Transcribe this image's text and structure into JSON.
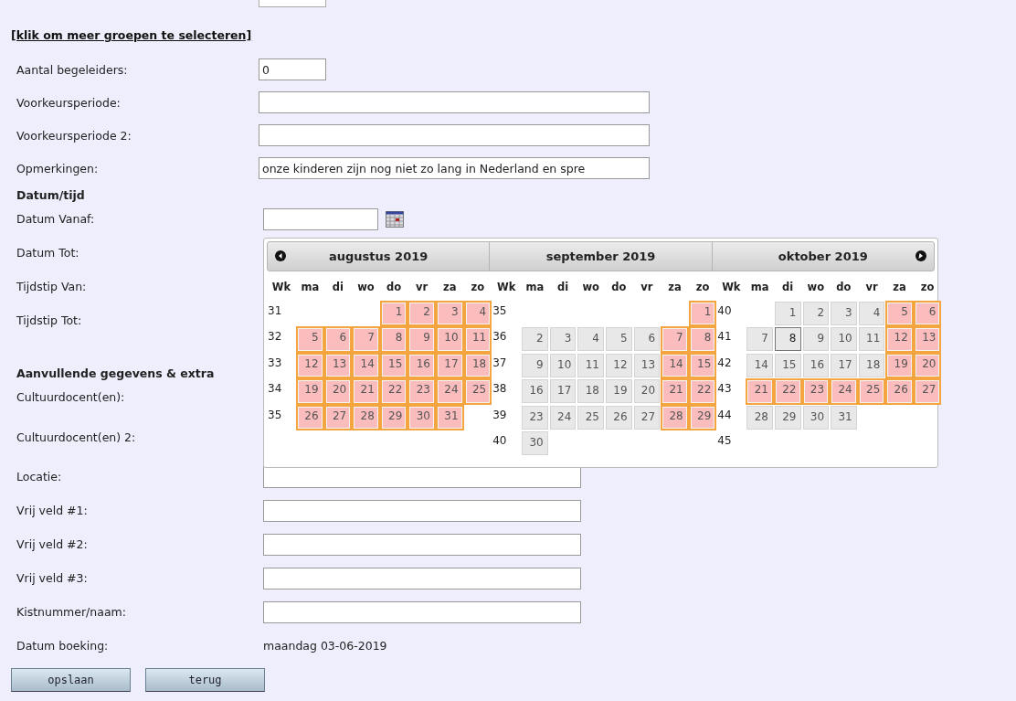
{
  "link": "[klik om meer groepen te selecteren]",
  "fields": [
    {
      "label": "Aantal begeleiders:",
      "kind": "short",
      "value": "0"
    },
    {
      "label": "Voorkeursperiode:",
      "kind": "wide"
    },
    {
      "label": "Voorkeursperiode 2:",
      "kind": "wide"
    },
    {
      "label": "Opmerkingen:",
      "kind": "wide",
      "value": "onze kinderen zijn nog niet zo lang in Nederland en spre"
    }
  ],
  "datetime": {
    "heading": "Datum/tijd",
    "rows": [
      {
        "label": "Datum Vanaf:",
        "kind": "date"
      },
      {
        "label": "Datum Tot:",
        "kind": "covered"
      },
      {
        "label": "Tijdstip Van:",
        "kind": "covered"
      },
      {
        "label": "Tijdstip Tot:",
        "kind": "covered"
      }
    ]
  },
  "extra": {
    "heading": "Aanvullende gegevens & extra",
    "rows": [
      {
        "label": "Cultuurdocent(en):",
        "kind": "covered"
      },
      {
        "label": "Cultuurdocent(en) 2:",
        "kind": "covered"
      },
      {
        "label": "Locatie:",
        "kind": "text"
      },
      {
        "label": "Vrij veld #1:",
        "kind": "text"
      },
      {
        "label": "Vrij veld #2:",
        "kind": "text"
      },
      {
        "label": "Vrij veld #3:",
        "kind": "text"
      },
      {
        "label": "Kistnummer/naam:",
        "kind": "text"
      },
      {
        "label": "Datum boeking:",
        "kind": "static",
        "value": "maandag 03-06-2019"
      }
    ]
  },
  "buttons": [
    "opslaan",
    "terug"
  ],
  "calendar": {
    "months": [
      {
        "title": "augustus 2019",
        "header": [
          "Wk",
          "ma",
          "di",
          "wo",
          "do",
          "vr",
          "za",
          "zo"
        ],
        "weeks": [
          {
            "wk": "31",
            "kind": "first",
            "days": [
              {
                "n": "1",
                "marked": true,
                "today": false
              },
              {
                "n": "2",
                "marked": true,
                "today": false
              },
              {
                "n": "3",
                "marked": true,
                "today": false
              },
              {
                "n": "4",
                "marked": true,
                "today": false
              }
            ]
          },
          {
            "wk": "32",
            "days": [
              {
                "n": "5",
                "marked": true,
                "today": false
              },
              {
                "n": "6",
                "marked": true,
                "today": false
              },
              {
                "n": "7",
                "marked": true,
                "today": false
              },
              {
                "n": "8",
                "marked": true,
                "today": false
              },
              {
                "n": "9",
                "marked": true,
                "today": false
              },
              {
                "n": "10",
                "marked": true,
                "today": false
              },
              {
                "n": "11",
                "marked": true,
                "today": false
              }
            ]
          },
          {
            "wk": "33",
            "days": [
              {
                "n": "12",
                "marked": true,
                "today": false
              },
              {
                "n": "13",
                "marked": true,
                "today": false
              },
              {
                "n": "14",
                "marked": true,
                "today": false
              },
              {
                "n": "15",
                "marked": true,
                "today": false
              },
              {
                "n": "16",
                "marked": true,
                "today": false
              },
              {
                "n": "17",
                "marked": true,
                "today": false
              },
              {
                "n": "18",
                "marked": true,
                "today": false
              }
            ]
          },
          {
            "wk": "34",
            "days": [
              {
                "n": "19",
                "marked": true,
                "today": false
              },
              {
                "n": "20",
                "marked": true,
                "today": false
              },
              {
                "n": "21",
                "marked": true,
                "today": false
              },
              {
                "n": "22",
                "marked": true,
                "today": false
              },
              {
                "n": "23",
                "marked": true,
                "today": false
              },
              {
                "n": "24",
                "marked": true,
                "today": false
              },
              {
                "n": "25",
                "marked": true,
                "today": false
              }
            ]
          },
          {
            "wk": "35",
            "days": [
              {
                "n": "26",
                "marked": true,
                "today": false
              },
              {
                "n": "27",
                "marked": true,
                "today": false
              },
              {
                "n": "28",
                "marked": true,
                "today": false
              },
              {
                "n": "29",
                "marked": true,
                "today": false
              },
              {
                "n": "30",
                "marked": true,
                "today": false
              },
              {
                "n": "31",
                "marked": true,
                "today": false
              }
            ]
          }
        ]
      },
      {
        "title": "september 2019",
        "header": [
          "Wk",
          "ma",
          "di",
          "wo",
          "do",
          "vr",
          "za",
          "zo"
        ],
        "weeks": [
          {
            "wk": "35",
            "kind": "first",
            "days": [
              {
                "n": "1",
                "marked": true,
                "today": false
              }
            ]
          },
          {
            "wk": "36",
            "days": [
              {
                "n": "2",
                "marked": false,
                "today": false
              },
              {
                "n": "3",
                "marked": false,
                "today": false
              },
              {
                "n": "4",
                "marked": false,
                "today": false
              },
              {
                "n": "5",
                "marked": false,
                "today": false
              },
              {
                "n": "6",
                "marked": false,
                "today": false
              },
              {
                "n": "7",
                "marked": true,
                "today": false
              },
              {
                "n": "8",
                "marked": true,
                "today": false
              }
            ]
          },
          {
            "wk": "37",
            "days": [
              {
                "n": "9",
                "marked": false,
                "today": false
              },
              {
                "n": "10",
                "marked": false,
                "today": false
              },
              {
                "n": "11",
                "marked": false,
                "today": false
              },
              {
                "n": "12",
                "marked": false,
                "today": false
              },
              {
                "n": "13",
                "marked": false,
                "today": false
              },
              {
                "n": "14",
                "marked": true,
                "today": false
              },
              {
                "n": "15",
                "marked": true,
                "today": false
              }
            ]
          },
          {
            "wk": "38",
            "days": [
              {
                "n": "16",
                "marked": false,
                "today": false
              },
              {
                "n": "17",
                "marked": false,
                "today": false
              },
              {
                "n": "18",
                "marked": false,
                "today": false
              },
              {
                "n": "19",
                "marked": false,
                "today": false
              },
              {
                "n": "20",
                "marked": false,
                "today": false
              },
              {
                "n": "21",
                "marked": true,
                "today": false
              },
              {
                "n": "22",
                "marked": true,
                "today": false
              }
            ]
          },
          {
            "wk": "39",
            "days": [
              {
                "n": "23",
                "marked": false,
                "today": false
              },
              {
                "n": "24",
                "marked": false,
                "today": false
              },
              {
                "n": "25",
                "marked": false,
                "today": false
              },
              {
                "n": "26",
                "marked": false,
                "today": false
              },
              {
                "n": "27",
                "marked": false,
                "today": false
              },
              {
                "n": "28",
                "marked": true,
                "today": false
              },
              {
                "n": "29",
                "marked": true,
                "today": false
              }
            ]
          },
          {
            "wk": "40",
            "days": [
              {
                "n": "30",
                "marked": false,
                "today": false
              }
            ]
          }
        ]
      },
      {
        "title": "oktober 2019",
        "header": [
          "Wk",
          "ma",
          "di",
          "wo",
          "do",
          "vr",
          "za",
          "zo"
        ],
        "weeks": [
          {
            "wk": "40",
            "kind": "first",
            "days": [
              {
                "n": "1",
                "marked": false,
                "today": false
              },
              {
                "n": "2",
                "marked": false,
                "today": false
              },
              {
                "n": "3",
                "marked": false,
                "today": false
              },
              {
                "n": "4",
                "marked": false,
                "today": false
              },
              {
                "n": "5",
                "marked": true,
                "today": false
              },
              {
                "n": "6",
                "marked": true,
                "today": false
              }
            ]
          },
          {
            "wk": "41",
            "days": [
              {
                "n": "7",
                "marked": false,
                "today": false
              },
              {
                "n": "8",
                "marked": false,
                "today": true
              },
              {
                "n": "9",
                "marked": false,
                "today": false
              },
              {
                "n": "10",
                "marked": false,
                "today": false
              },
              {
                "n": "11",
                "marked": false,
                "today": false
              },
              {
                "n": "12",
                "marked": true,
                "today": false
              },
              {
                "n": "13",
                "marked": true,
                "today": false
              }
            ]
          },
          {
            "wk": "42",
            "days": [
              {
                "n": "14",
                "marked": false,
                "today": false
              },
              {
                "n": "15",
                "marked": false,
                "today": false
              },
              {
                "n": "16",
                "marked": false,
                "today": false
              },
              {
                "n": "17",
                "marked": false,
                "today": false
              },
              {
                "n": "18",
                "marked": false,
                "today": false
              },
              {
                "n": "19",
                "marked": true,
                "today": false
              },
              {
                "n": "20",
                "marked": true,
                "today": false
              }
            ]
          },
          {
            "wk": "43",
            "days": [
              {
                "n": "21",
                "marked": true,
                "today": false
              },
              {
                "n": "22",
                "marked": true,
                "today": false
              },
              {
                "n": "23",
                "marked": true,
                "today": false
              },
              {
                "n": "24",
                "marked": true,
                "today": false
              },
              {
                "n": "25",
                "marked": true,
                "today": false
              },
              {
                "n": "26",
                "marked": true,
                "today": false
              },
              {
                "n": "27",
                "marked": true,
                "today": false
              }
            ]
          },
          {
            "wk": "44",
            "days": [
              {
                "n": "28",
                "marked": false,
                "today": false
              },
              {
                "n": "29",
                "marked": false,
                "today": false
              },
              {
                "n": "30",
                "marked": false,
                "today": false
              },
              {
                "n": "31",
                "marked": false,
                "today": false
              }
            ]
          },
          {
            "wk": "45"
          }
        ]
      }
    ]
  }
}
